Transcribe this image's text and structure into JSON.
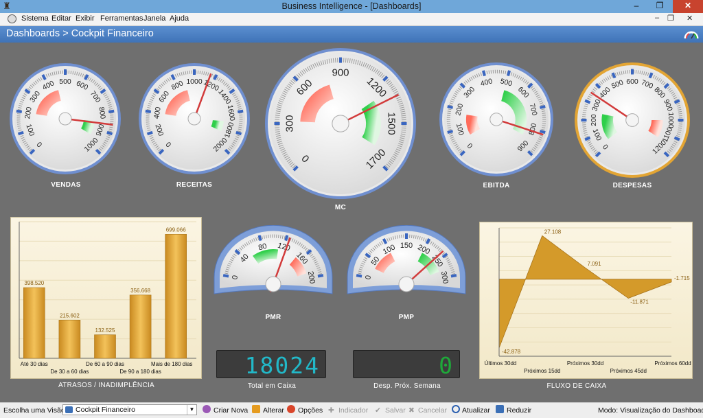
{
  "window": {
    "title": "Business Intelligence - [Dashboards]",
    "minimize_glyph": "‒",
    "restore_glyph": "❐",
    "close_glyph": "✕"
  },
  "menu": {
    "items": [
      "Sistema",
      "Editar",
      "Exibir",
      "Ferramentas",
      "Janela",
      "Ajuda"
    ],
    "mdi_min": "‒",
    "mdi_restore": "❐",
    "mdi_close": "✕"
  },
  "header": {
    "breadcrumb": "Dashboards > Cockpit Financeiro"
  },
  "gauges": [
    {
      "id": "vendas",
      "label": "VENDAS",
      "min": 0,
      "max": 1000,
      "ticks": [
        "0",
        "100",
        "200",
        "300",
        "400",
        "500",
        "600",
        "700",
        "800",
        "900",
        "1000"
      ],
      "value": 860,
      "ring": "#6f8fd0",
      "bands": [
        {
          "from": 200,
          "to": 450,
          "color": "red"
        },
        {
          "from": 850,
          "to": 950,
          "color": "green"
        }
      ]
    },
    {
      "id": "receitas",
      "label": "RECEITAS",
      "min": 0,
      "max": 2000,
      "ticks": [
        "0",
        "200",
        "400",
        "600",
        "800",
        "1000",
        "1200",
        "1400",
        "1600",
        "1800",
        "2000"
      ],
      "value": 1150,
      "ring": "#6f8fd0",
      "bands": [
        {
          "from": 400,
          "to": 900,
          "color": "red"
        },
        {
          "from": 1700,
          "to": 1850,
          "color": "green"
        }
      ]
    },
    {
      "id": "mc",
      "label": "MC",
      "min": 0,
      "max": 1700,
      "ticks": [
        "0",
        "300",
        "600",
        "900",
        "1200",
        "1500",
        "1700"
      ],
      "value": 1250,
      "ring": "#6f8fd0",
      "bands": [
        {
          "from": 300,
          "to": 750,
          "color": "red"
        },
        {
          "from": 1200,
          "to": 1620,
          "color": "green"
        }
      ]
    },
    {
      "id": "ebitda",
      "label": "EBITDA",
      "min": 0,
      "max": 900,
      "ticks": [
        "0",
        "100",
        "200",
        "300",
        "400",
        "500",
        "600",
        "700",
        "800",
        "900"
      ],
      "value": 810,
      "ring": "#6f8fd0",
      "bands": [
        {
          "from": 50,
          "to": 180,
          "color": "red"
        },
        {
          "from": 500,
          "to": 850,
          "color": "green"
        }
      ]
    },
    {
      "id": "despesas",
      "label": "DESPESAS",
      "min": 0,
      "max": 1200,
      "ticks": [
        "0",
        "100",
        "200",
        "300",
        "400",
        "500",
        "600",
        "700",
        "800",
        "900",
        "1000",
        "1100",
        "1200"
      ],
      "value": 350,
      "ring": "#e3a534",
      "bands": [
        {
          "from": 30,
          "to": 250,
          "color": "green"
        },
        {
          "from": 1000,
          "to": 1150,
          "color": "red"
        }
      ]
    }
  ],
  "half_gauges": [
    {
      "id": "pmr",
      "label": "PMR",
      "min": 0,
      "max": 200,
      "ticks": [
        "0",
        "40",
        "80",
        "120",
        "160",
        "200"
      ],
      "value": 125,
      "bands": [
        {
          "from": 55,
          "to": 110,
          "color": "green"
        },
        {
          "from": 150,
          "to": 190,
          "color": "red"
        }
      ]
    },
    {
      "id": "pmp",
      "label": "PMP",
      "min": 0,
      "max": 300,
      "ticks": [
        "0",
        "50",
        "100",
        "150",
        "200",
        "250",
        "300"
      ],
      "value": 240,
      "bands": [
        {
          "from": 30,
          "to": 100,
          "color": "red"
        },
        {
          "from": 200,
          "to": 280,
          "color": "green"
        }
      ]
    }
  ],
  "readouts": [
    {
      "id": "caixa",
      "label": "Total  em Caixa",
      "value": "18024",
      "color": "#22b8c8"
    },
    {
      "id": "desp",
      "label": "Desp. Próx. Semana",
      "value": "0",
      "color": "#1fa83a"
    }
  ],
  "chart_data": [
    {
      "type": "bar",
      "title": "ATRASOS / INADIMPLÊNCIA",
      "categories": [
        "Até 30 dias",
        "De 30 a 60 dias",
        "De 60 a 90 dias",
        "De 90 a 180 dias",
        "Mais de 180 dias"
      ],
      "values": [
        398.52,
        215.602,
        132.525,
        356.668,
        699.066
      ],
      "data_labels": [
        "398.520",
        "215.602",
        "132.525",
        "356.668",
        "699.066"
      ],
      "ylim": [
        0,
        770
      ],
      "grid": true,
      "color": "#e0a63a"
    },
    {
      "type": "area",
      "title": "FLUXO DE CAIXA",
      "categories": [
        "Últimos 30dd",
        "Próximos 15dd",
        "Próximos 30dd",
        "Próximos 45dd",
        "Próximos 60dd"
      ],
      "values": [
        -42.878,
        27.108,
        7.091,
        -11.871,
        -1.715
      ],
      "data_labels": [
        "-42.878",
        "27.108",
        "7.091",
        "-11.871",
        "-1.715"
      ],
      "ylim": [
        -48,
        32
      ],
      "grid": true,
      "color": "#d49a2a"
    }
  ],
  "statusbar": {
    "view_label": "Escolha uma Visão:",
    "view_value": "Cockpit Financeiro",
    "criar": "Criar Nova",
    "alterar": "Alterar",
    "opcoes": "Opções",
    "indicador": "Indicador",
    "salvar": "Salvar",
    "cancelar": "Cancelar",
    "atualizar": "Atualizar",
    "reduzir": "Reduzir",
    "mode": "Modo: Visualização do Dashboad"
  }
}
